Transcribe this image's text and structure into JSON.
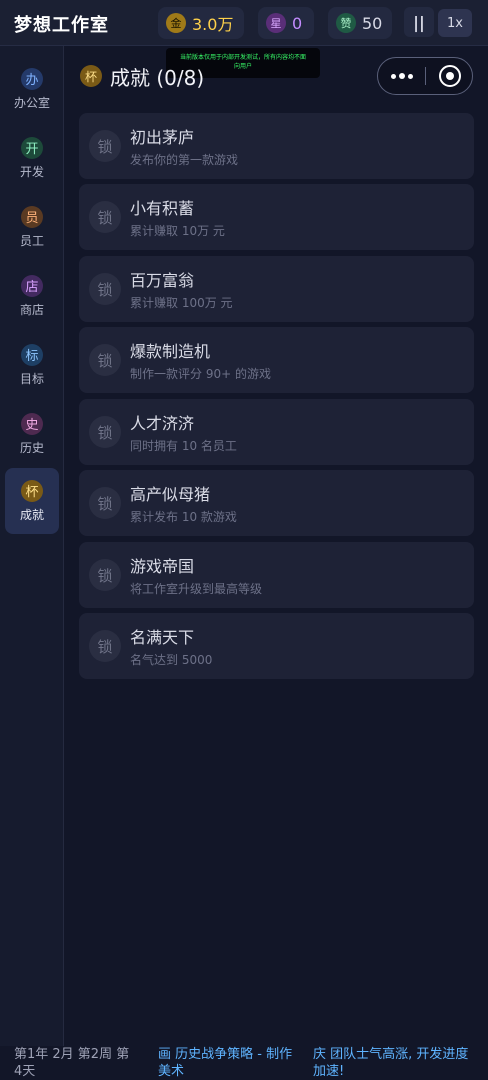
{
  "header": {
    "title": "梦想工作室",
    "gold": {
      "icon": "金",
      "value": "3.0万"
    },
    "stars": {
      "icon": "星",
      "value": "0"
    },
    "likes": {
      "icon": "赞",
      "value": "50"
    },
    "pause_label": "||",
    "speed_label": "1x"
  },
  "banner": {
    "line1": "当前版本仅用于内部开发测试，所有内容均不面",
    "line2": "向用户"
  },
  "sidebar": {
    "items": [
      {
        "icon": "办",
        "label": "办公室"
      },
      {
        "icon": "开",
        "label": "开发"
      },
      {
        "icon": "员",
        "label": "员工"
      },
      {
        "icon": "店",
        "label": "商店"
      },
      {
        "icon": "标",
        "label": "目标"
      },
      {
        "icon": "史",
        "label": "历史"
      },
      {
        "icon": "杯",
        "label": "成就"
      }
    ],
    "active_index": 6
  },
  "page": {
    "icon": "杯",
    "title": "成就 (0/8)"
  },
  "achievements": [
    {
      "lock": "锁",
      "title": "初出茅庐",
      "desc": "发布你的第一款游戏"
    },
    {
      "lock": "锁",
      "title": "小有积蓄",
      "desc": "累计赚取 10万 元"
    },
    {
      "lock": "锁",
      "title": "百万富翁",
      "desc": "累计赚取 100万 元"
    },
    {
      "lock": "锁",
      "title": "爆款制造机",
      "desc": "制作一款评分 90+ 的游戏"
    },
    {
      "lock": "锁",
      "title": "人才济济",
      "desc": "同时拥有 10 名员工"
    },
    {
      "lock": "锁",
      "title": "高产似母猪",
      "desc": "累计发布 10 款游戏"
    },
    {
      "lock": "锁",
      "title": "游戏帝国",
      "desc": "将工作室升级到最高等级"
    },
    {
      "lock": "锁",
      "title": "名满天下",
      "desc": "名气达到 5000"
    }
  ],
  "footer": {
    "date": "第1年 2月 第2周 第4天",
    "news1": "画 历史战争策略 - 制作美术",
    "news2": "庆 团队士气高涨, 开发进度加速!"
  }
}
